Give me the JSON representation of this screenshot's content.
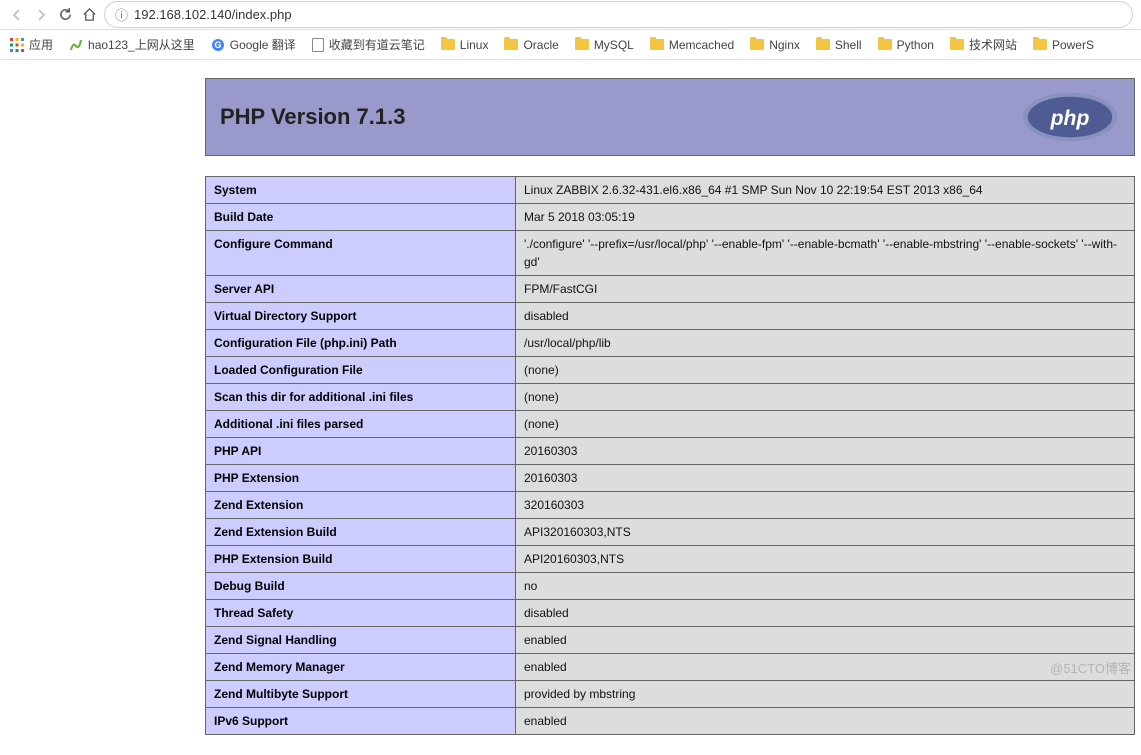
{
  "browser": {
    "url": "192.168.102.140/index.php",
    "bookmarks_label": "应用",
    "bookmarks": [
      {
        "label": "hao123_上网从这里",
        "icon": "hao"
      },
      {
        "label": "Google 翻译",
        "icon": "google"
      },
      {
        "label": "收藏到有道云笔记",
        "icon": "page"
      },
      {
        "label": "Linux",
        "icon": "folder"
      },
      {
        "label": "Oracle",
        "icon": "folder"
      },
      {
        "label": "MySQL",
        "icon": "folder"
      },
      {
        "label": "Memcached",
        "icon": "folder"
      },
      {
        "label": "Nginx",
        "icon": "folder"
      },
      {
        "label": "Shell",
        "icon": "folder"
      },
      {
        "label": "Python",
        "icon": "folder"
      },
      {
        "label": "技术网站",
        "icon": "folder"
      },
      {
        "label": "PowerS",
        "icon": "folder"
      }
    ]
  },
  "phpinfo": {
    "title": "PHP Version 7.1.3",
    "rows": [
      {
        "k": "System",
        "v": "Linux ZABBIX 2.6.32-431.el6.x86_64 #1 SMP Sun Nov 10 22:19:54 EST 2013 x86_64"
      },
      {
        "k": "Build Date",
        "v": "Mar 5 2018 03:05:19"
      },
      {
        "k": "Configure Command",
        "v": "'./configure' '--prefix=/usr/local/php' '--enable-fpm' '--enable-bcmath' '--enable-mbstring' '--enable-sockets' '--with-gd'"
      },
      {
        "k": "Server API",
        "v": "FPM/FastCGI"
      },
      {
        "k": "Virtual Directory Support",
        "v": "disabled"
      },
      {
        "k": "Configuration File (php.ini) Path",
        "v": "/usr/local/php/lib"
      },
      {
        "k": "Loaded Configuration File",
        "v": "(none)"
      },
      {
        "k": "Scan this dir for additional .ini files",
        "v": "(none)"
      },
      {
        "k": "Additional .ini files parsed",
        "v": "(none)"
      },
      {
        "k": "PHP API",
        "v": "20160303"
      },
      {
        "k": "PHP Extension",
        "v": "20160303"
      },
      {
        "k": "Zend Extension",
        "v": "320160303"
      },
      {
        "k": "Zend Extension Build",
        "v": "API320160303,NTS"
      },
      {
        "k": "PHP Extension Build",
        "v": "API20160303,NTS"
      },
      {
        "k": "Debug Build",
        "v": "no"
      },
      {
        "k": "Thread Safety",
        "v": "disabled"
      },
      {
        "k": "Zend Signal Handling",
        "v": "enabled"
      },
      {
        "k": "Zend Memory Manager",
        "v": "enabled"
      },
      {
        "k": "Zend Multibyte Support",
        "v": "provided by mbstring"
      },
      {
        "k": "IPv6 Support",
        "v": "enabled"
      }
    ]
  },
  "watermark": "@51CTO博客"
}
